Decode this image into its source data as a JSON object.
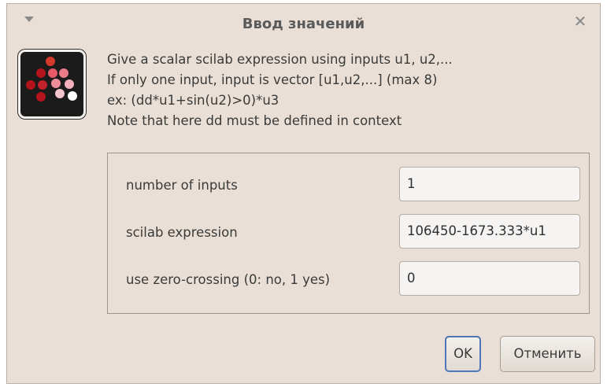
{
  "window": {
    "title": "Ввод значений",
    "menu_icon": "chevron-down-icon",
    "close_icon": "close-icon",
    "close_glyph": "✕"
  },
  "app_icon": {
    "name": "scicos-icon",
    "colors": {
      "background": "#1b1b1b",
      "dot_dark": "#b3141c",
      "dot_mid": "#e65a68",
      "dot_light": "#f3b0bb",
      "dot_white": "#ffffff"
    }
  },
  "description": {
    "lines": [
      "Give a scalar scilab expression using inputs u1, u2,...",
      "If only one input, input is vector [u1,u2,...] (max 8)",
      "ex: (dd*u1+sin(u2)>0)*u3",
      "Note that here dd must be defined in context"
    ]
  },
  "form": {
    "fields": [
      {
        "label": "number of inputs",
        "value": "1"
      },
      {
        "label": "scilab expression",
        "value": "106450-1673.333*u1"
      },
      {
        "label": "use zero-crossing (0: no, 1 yes)",
        "value": "0"
      }
    ]
  },
  "buttons": {
    "ok_label": "OK",
    "cancel_label": "Отменить"
  },
  "colors": {
    "window_bg": "#e9dfd6",
    "focus_border": "#4f76b6"
  }
}
